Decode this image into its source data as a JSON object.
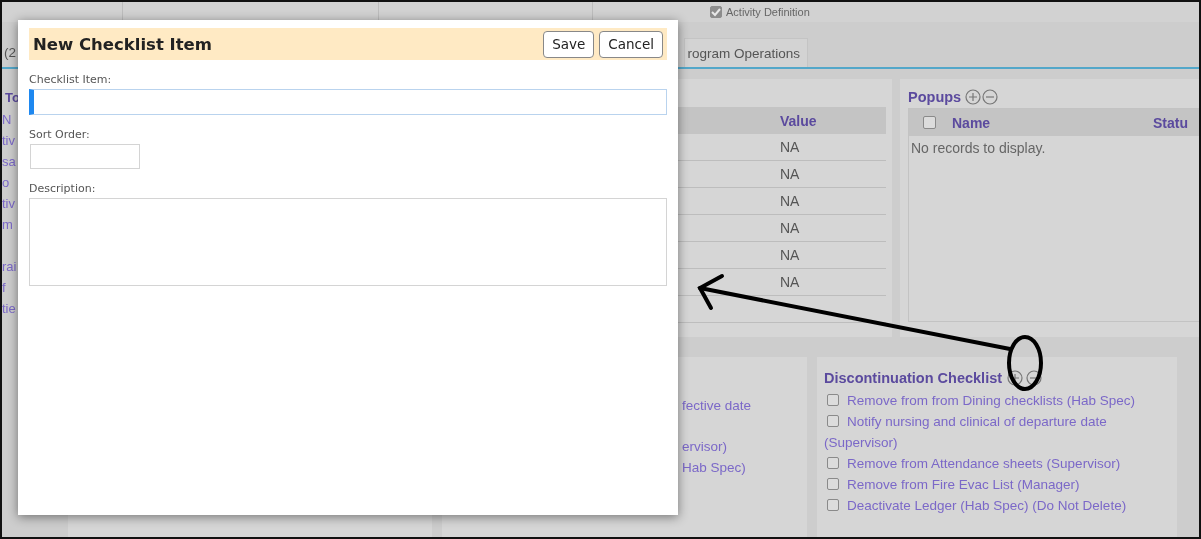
{
  "top_bar": {
    "activity_definition": {
      "label": "Activity Definition",
      "checked": true
    }
  },
  "tabs": [
    {
      "label": "(2",
      "selected": false
    },
    {
      "label": "rogram Operations",
      "selected": false
    }
  ],
  "left_panel": {
    "heading": "To",
    "links": [
      "N",
      "tiv",
      "sa",
      "o",
      "tiv",
      "m",
      "rai",
      "f",
      "tie"
    ]
  },
  "values_table": {
    "columns": [
      "Value"
    ],
    "rows": [
      [
        "NA"
      ],
      [
        "NA"
      ],
      [
        "NA"
      ],
      [
        "NA"
      ],
      [
        "NA"
      ],
      [
        "NA"
      ]
    ]
  },
  "popups": {
    "title": "Popups",
    "select_all_checked": false,
    "columns": [
      "Name",
      "Statu"
    ],
    "empty_message": "No records to display."
  },
  "bottom_middle": {
    "lines": [
      "fective date",
      "ervisor)",
      "Hab Spec)"
    ]
  },
  "discontinuation_checklist": {
    "title": "Discontinuation Checklist",
    "items": [
      {
        "label": "Remove from from Dining checklists (Hab Spec)",
        "checked": false
      },
      {
        "label": "Notify nursing and clinical of departure date (Supervisor)",
        "checked": false
      },
      {
        "label": "Remove from Attendance sheets (Supervisor)",
        "checked": false
      },
      {
        "label": "Remove from Fire Evac List (Manager)",
        "checked": false
      },
      {
        "label": "Deactivate Ledger (Hab Spec) (Do Not Delete)",
        "checked": false
      }
    ]
  },
  "dialog": {
    "title": "New Checklist Item",
    "buttons": [
      "Save",
      "Cancel"
    ],
    "fields": [
      {
        "label": "Checklist Item:",
        "kind": "text",
        "focused": true
      },
      {
        "label": "Sort Order:",
        "kind": "short",
        "focused": false
      },
      {
        "label": "Description:",
        "kind": "textarea",
        "focused": false
      }
    ]
  }
}
